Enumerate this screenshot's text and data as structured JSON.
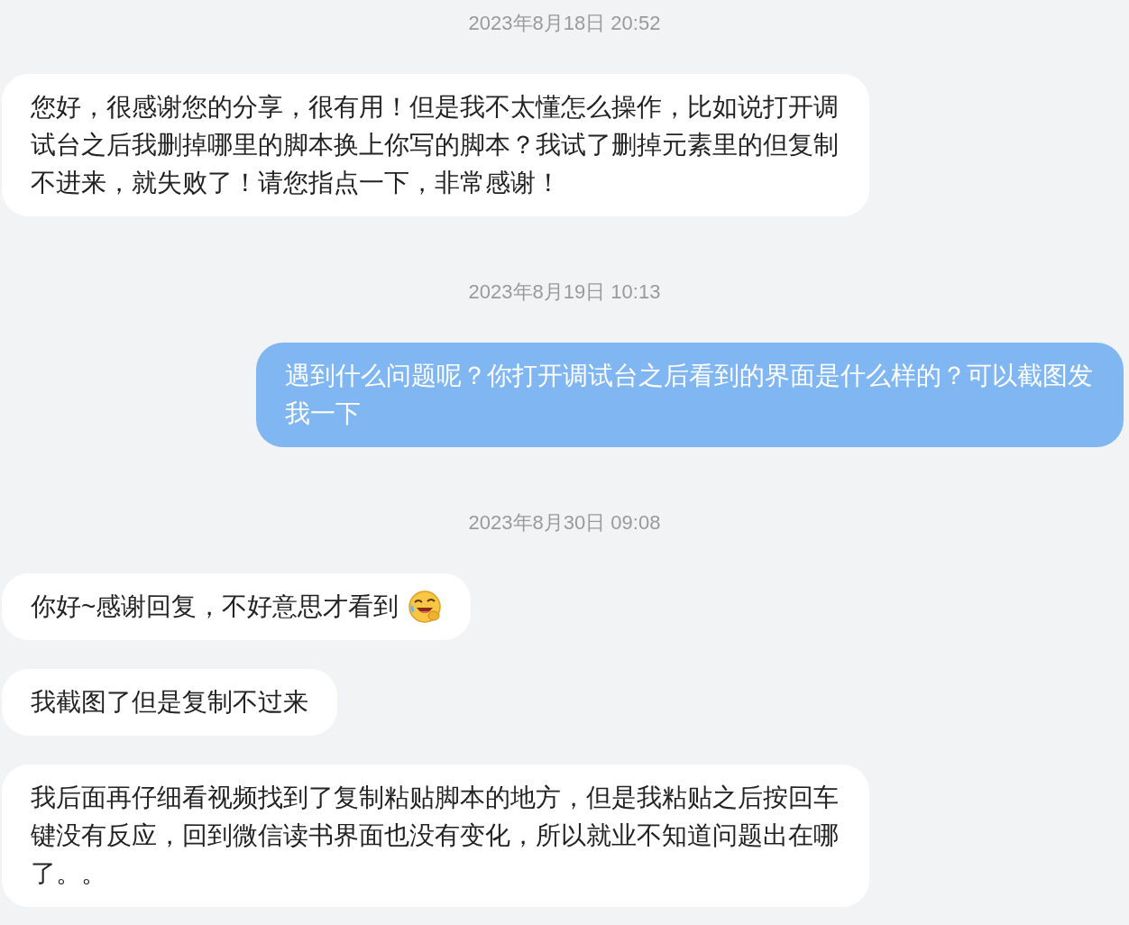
{
  "chat": [
    {
      "kind": "time",
      "text": "2023年8月18日 20:52"
    },
    {
      "kind": "received",
      "text": "您好，很感谢您的分享，很有用！但是我不太懂怎么操作，比如说打开调试台之后我删掉哪里的脚本换上你写的脚本？我试了删掉元素里的但复制不进来，就失败了！请您指点一下，非常感谢！",
      "emoji": false
    },
    {
      "kind": "time",
      "text": "2023年8月19日 10:13"
    },
    {
      "kind": "sent",
      "text": "遇到什么问题呢？你打开调试台之后看到的界面是什么样的？可以截图发我一下",
      "emoji": false
    },
    {
      "kind": "time",
      "text": "2023年8月30日 09:08"
    },
    {
      "kind": "received",
      "text": "你好~感谢回复，不好意思才看到",
      "emoji": true
    },
    {
      "kind": "received",
      "text": "我截图了但是复制不过来",
      "emoji": false
    },
    {
      "kind": "received",
      "text": "我后面再仔细看视频找到了复制粘贴脚本的地方，但是我粘贴之后按回车键没有反应，回到微信读书界面也没有变化，所以就业不知道问题出在哪了。。",
      "emoji": false
    }
  ]
}
